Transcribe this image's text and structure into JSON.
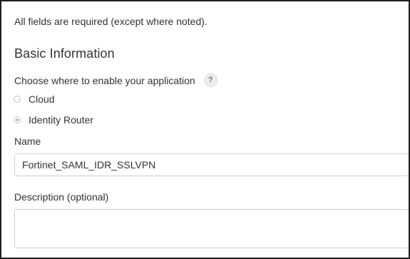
{
  "form": {
    "required_note": "All fields are required (except where noted).",
    "section_title": "Basic Information",
    "enable_question": "Choose where to enable your application",
    "help_icon_glyph": "?",
    "options": [
      {
        "label": "Cloud",
        "selected": false
      },
      {
        "label": "Identity Router",
        "selected": true
      }
    ],
    "name_label": "Name",
    "name_value": "Fortinet_SAML_IDR_SSLVPN",
    "description_label": "Description (optional)",
    "description_value": ""
  }
}
